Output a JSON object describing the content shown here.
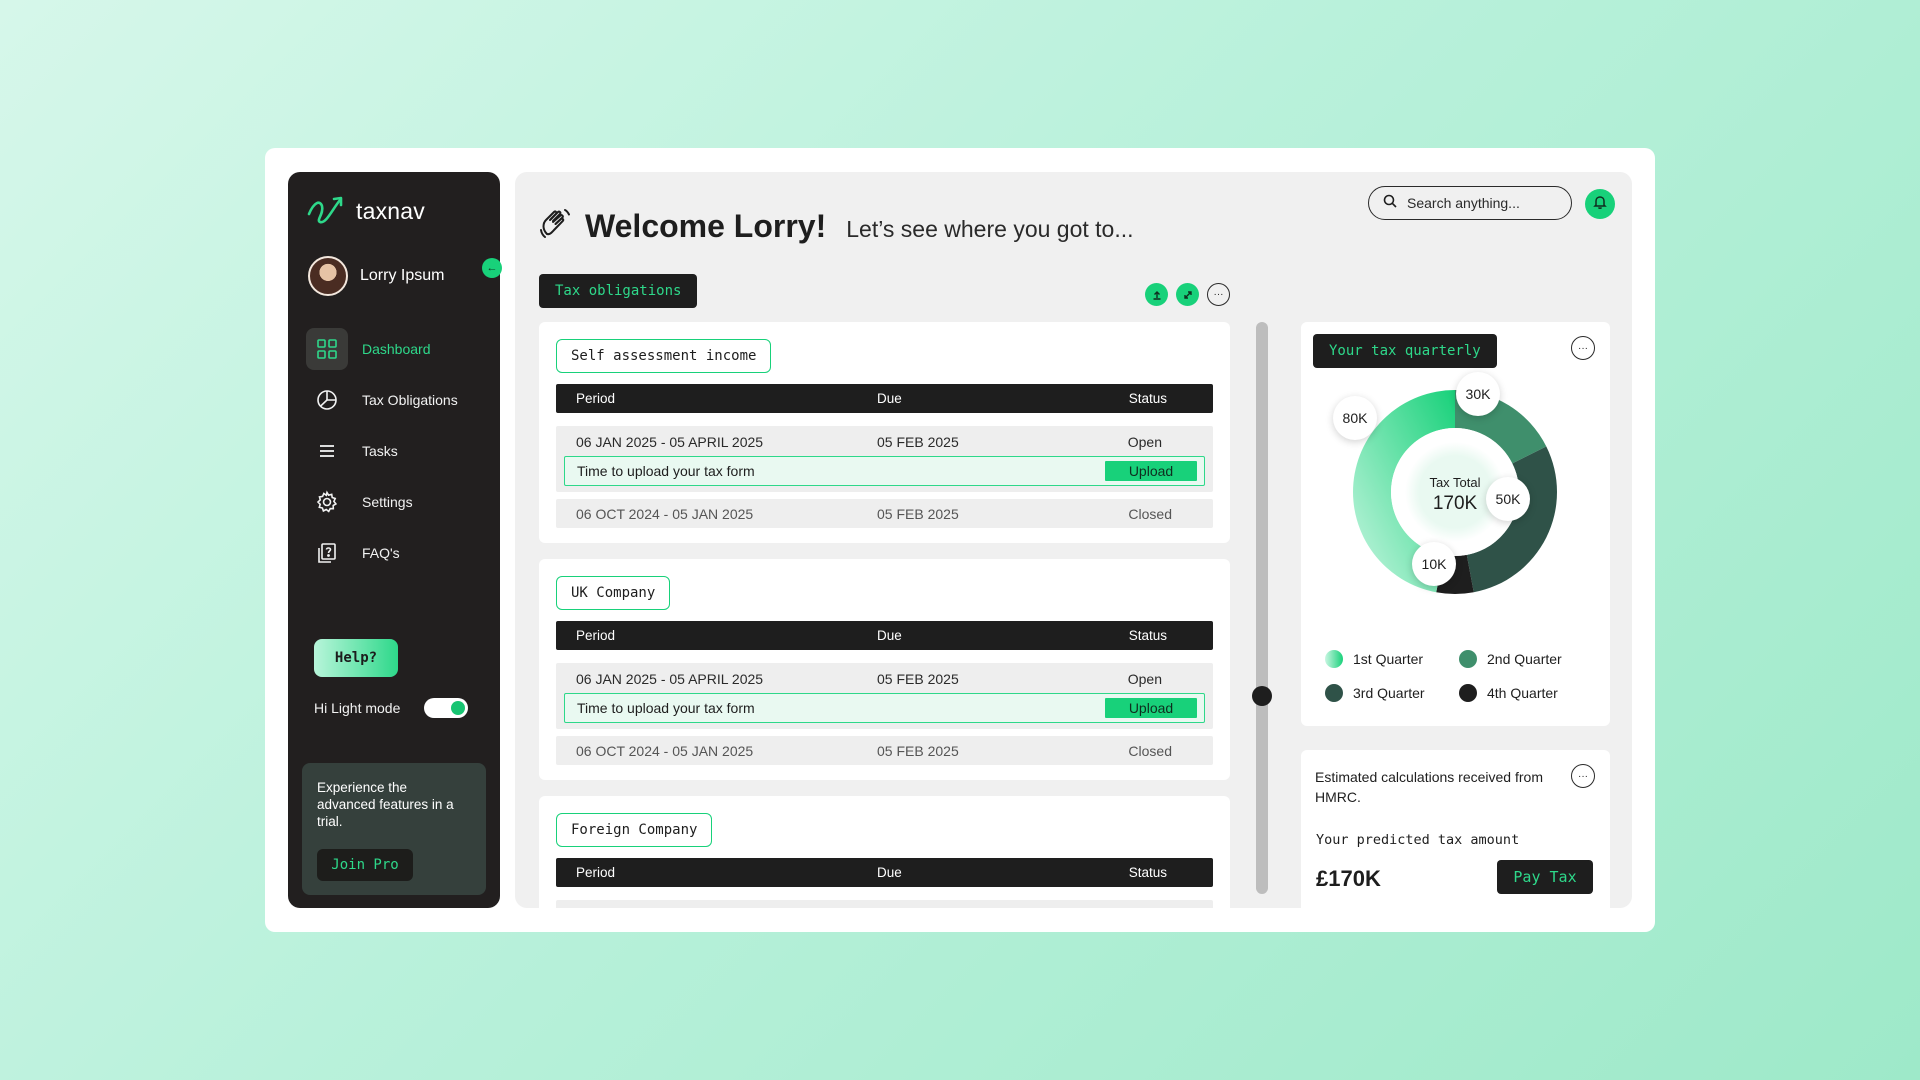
{
  "app": {
    "name": "taxnav"
  },
  "user": {
    "name": "Lorry Ipsum"
  },
  "sidebar": {
    "items": [
      {
        "label": "Dashboard",
        "icon": "grid-icon",
        "active": true
      },
      {
        "label": "Tax Obligations",
        "icon": "pie-chart-icon",
        "active": false
      },
      {
        "label": "Tasks",
        "icon": "list-icon",
        "active": false
      },
      {
        "label": "Settings",
        "icon": "gear-icon",
        "active": false
      },
      {
        "label": "FAQ's",
        "icon": "faq-icon",
        "active": false
      }
    ],
    "help_label": "Help?",
    "mode_label": "Hi Light mode",
    "mode_on": true,
    "promo_text": "Experience the advanced features in a trial.",
    "join_label": "Join Pro"
  },
  "header": {
    "title": "Welcome Lorry!",
    "subtitle": "Let’s see where you got to...",
    "search_placeholder": "Search anything..."
  },
  "tax_obligations": {
    "tag": "Tax obligations",
    "columns": {
      "period": "Period",
      "due": "Due",
      "status": "Status"
    },
    "upload_message": "Time to upload your tax form",
    "upload_label": "Upload",
    "cards": [
      {
        "title": "Self assessment income",
        "rows": [
          {
            "period": "06 JAN 2025 - 05 APRIL 2025",
            "due": "05 FEB 2025",
            "status": "Open"
          },
          {
            "period": "06 OCT 2024 - 05 JAN 2025",
            "due": "05 FEB 2025",
            "status": "Closed"
          }
        ]
      },
      {
        "title": "UK Company",
        "rows": [
          {
            "period": "06 JAN 2025 - 05 APRIL 2025",
            "due": "05 FEB 2025",
            "status": "Open"
          },
          {
            "period": "06 OCT 2024 - 05 JAN 2025",
            "due": "05 FEB 2025",
            "status": "Closed"
          }
        ]
      },
      {
        "title": "Foreign Company",
        "rows": []
      }
    ]
  },
  "quarterly": {
    "tag": "Your tax quarterly",
    "center_label": "Tax Total",
    "center_value": "170K",
    "slices": [
      {
        "name": "1st Quarter",
        "value": 80,
        "label": "80K",
        "color": "#18d17a"
      },
      {
        "name": "2nd Quarter",
        "value": 30,
        "label": "30K",
        "color": "#3f8f6c"
      },
      {
        "name": "3rd Quarter",
        "value": 50,
        "label": "50K",
        "color": "#2f5248"
      },
      {
        "name": "4th Quarter",
        "value": 10,
        "label": "10K",
        "color": "#1e1e1e"
      }
    ]
  },
  "estimate": {
    "title": "Estimated calculations received from HMRC.",
    "subtitle": "Your predicted tax amount",
    "amount": "£170K",
    "pay_label": "Pay Tax"
  },
  "colors": {
    "accent": "#18d17a",
    "dark": "#1e1e1e",
    "sidebar": "#221f1f"
  }
}
